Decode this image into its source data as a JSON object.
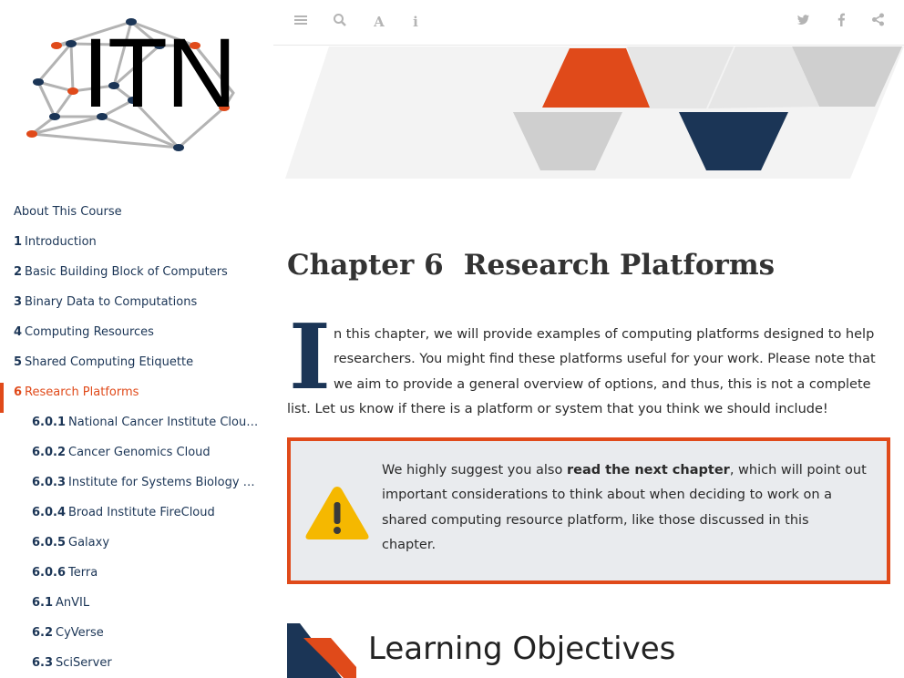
{
  "logo": {
    "text": "ITN"
  },
  "toolbar": {
    "left_icons": [
      "list-icon",
      "search-icon",
      "font-icon",
      "info-icon"
    ],
    "right_icons": [
      "twitter-icon",
      "facebook-icon",
      "share-icon"
    ]
  },
  "toc": [
    {
      "num": "",
      "label": "About This Course"
    },
    {
      "num": "1",
      "label": "Introduction"
    },
    {
      "num": "2",
      "label": "Basic Building Block of Computers"
    },
    {
      "num": "3",
      "label": "Binary Data to Computations"
    },
    {
      "num": "4",
      "label": "Computing Resources"
    },
    {
      "num": "5",
      "label": "Shared Computing Etiquette"
    },
    {
      "num": "6",
      "label": "Research Platforms"
    },
    {
      "num": "6.0.1",
      "label": "National Cancer Institute Cloud Resources"
    },
    {
      "num": "6.0.2",
      "label": "Cancer Genomics Cloud"
    },
    {
      "num": "6.0.3",
      "label": "Institute for Systems Biology (ISB) Cancer Gateway in the Cloud"
    },
    {
      "num": "6.0.4",
      "label": "Broad Institute FireCloud"
    },
    {
      "num": "6.0.5",
      "label": "Galaxy"
    },
    {
      "num": "6.0.6",
      "label": "Terra"
    },
    {
      "num": "6.1",
      "label": "AnVIL"
    },
    {
      "num": "6.2",
      "label": "CyVerse"
    },
    {
      "num": "6.3",
      "label": "SciServer"
    }
  ],
  "chapter": {
    "number": "Chapter 6",
    "title": "Research Platforms",
    "dropcap": "I",
    "intro_lines": [
      "n this chapter, we will provide examples of computing platforms designed to help",
      "researchers. You might find these platforms useful for your work. Please note that",
      "we aim to provide a general overview of options, and thus, this is not a complete",
      "list. Let us know if there is a platform or system that you think we should include!"
    ]
  },
  "callout": {
    "line1_pre": "We highly suggest you also ",
    "line1_bold": "read the next chapter",
    "line1_post": ", which will point out",
    "lines": [
      "important considerations to think about when deciding to work on a",
      "shared computing resource platform, like those discussed in this",
      "chapter."
    ]
  },
  "section": {
    "title": "Learning Objectives"
  },
  "colors": {
    "navy": "#1b3556",
    "accent": "#e04a1a",
    "callout_bg": "#e9ebee",
    "warning": "#f5b800"
  }
}
